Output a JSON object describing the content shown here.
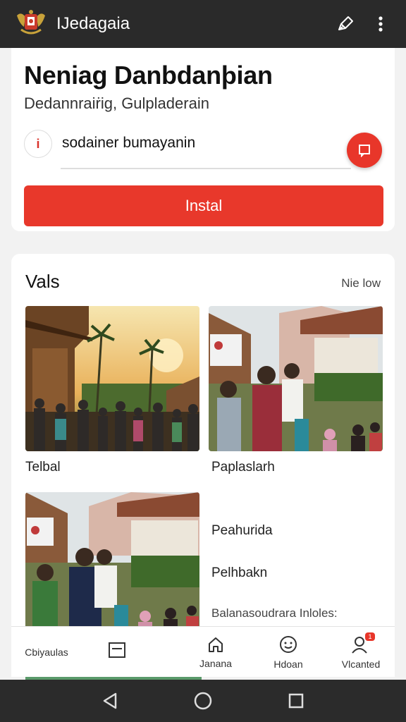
{
  "app_bar": {
    "title": "IJedagaia",
    "share_icon": "pen-icon",
    "more_icon": "more-vert-icon"
  },
  "header": {
    "title": "Neniag Danbdanþian",
    "subtitle": "Dedannraiṙig, Gulpladerain"
  },
  "search": {
    "value": "sodainer bumayanin",
    "info_glyph": "i"
  },
  "install": {
    "label": "Instal"
  },
  "vals": {
    "title": "Vals",
    "more_label": "Nie low",
    "cards": [
      {
        "caption": "Telbal"
      },
      {
        "caption": "Paplaslarh"
      }
    ],
    "list": [
      "Peahurida",
      "Pelhbakn",
      "Balanasoudrara Inloles:"
    ]
  },
  "bottom_nav": {
    "items": [
      {
        "label": "Cbiyaulas"
      },
      {
        "label": ""
      },
      {
        "label": "Janana"
      },
      {
        "label": "Hdoan"
      },
      {
        "label": "Vlcanted",
        "badge": "1"
      }
    ]
  },
  "colors": {
    "accent": "#e8382b",
    "app_bar": "#2a2a2a",
    "system_bar": "#2b2b2b"
  }
}
